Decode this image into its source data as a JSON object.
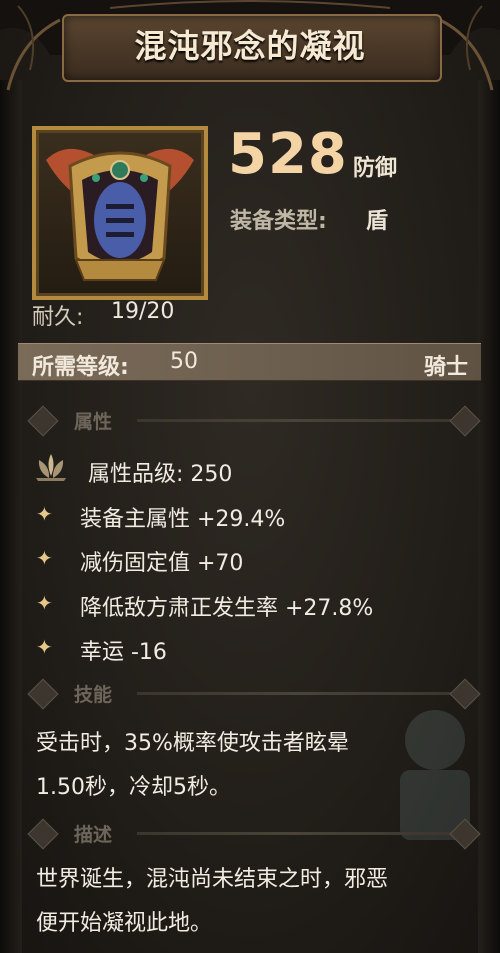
{
  "item": {
    "title": "混沌邪念的凝视",
    "power_value": "528",
    "power_unit": "防御",
    "equip_type_label": "装备类型:",
    "equip_type_value": "盾",
    "durability_label": "耐久:",
    "durability_value": "19/20",
    "requirement": {
      "label": "所需等级:",
      "value": "50",
      "class": "骑士"
    }
  },
  "sections": {
    "attributes_title": "属性",
    "skill_title": "技能",
    "description_title": "描述"
  },
  "attributes": {
    "grade": "属性品级: 250",
    "lines": [
      "装备主属性 +29.4%",
      "减伤固定值 +70",
      "降低敌方肃正发生率 +27.8%",
      "幸运 -16"
    ]
  },
  "skill": {
    "lines": [
      "受击时，35%概率使攻击者眩晕",
      "1.50秒，冷却5秒。"
    ]
  },
  "description": {
    "lines": [
      "世界诞生，混沌尚未结束之时，邪恶",
      "便开始凝视此地。"
    ]
  },
  "colors": {
    "power": "#f4d3a5",
    "frame_gold": "#b38a3e",
    "title_plate": "#4a3827",
    "requirement_bar": "#6d5f4f",
    "sparkle": "#e6c789"
  },
  "icons": [
    "shield-icon",
    "lotus-grade-icon",
    "sparkle-icon",
    "diamond-bullet-icon"
  ]
}
